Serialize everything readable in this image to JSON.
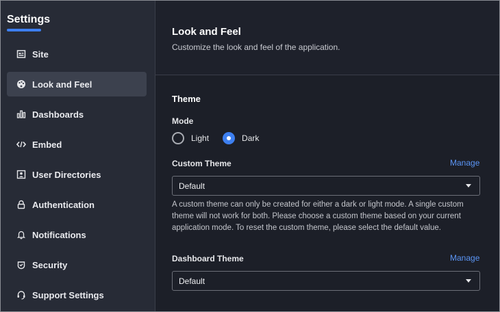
{
  "sidebar": {
    "title": "Settings",
    "items": [
      {
        "label": "Site",
        "icon": "site-icon",
        "active": false
      },
      {
        "label": "Look and Feel",
        "icon": "palette-icon",
        "active": true
      },
      {
        "label": "Dashboards",
        "icon": "bar-chart-icon",
        "active": false
      },
      {
        "label": "Embed",
        "icon": "code-icon",
        "active": false
      },
      {
        "label": "User Directories",
        "icon": "contact-card-icon",
        "active": false
      },
      {
        "label": "Authentication",
        "icon": "lock-icon",
        "active": false
      },
      {
        "label": "Notifications",
        "icon": "bell-icon",
        "active": false
      },
      {
        "label": "Security",
        "icon": "shield-icon",
        "active": false
      },
      {
        "label": "Support Settings",
        "icon": "headset-icon",
        "active": false
      }
    ]
  },
  "header": {
    "title": "Look and Feel",
    "subtitle": "Customize the look and feel of the application."
  },
  "theme": {
    "section_title": "Theme",
    "mode_label": "Mode",
    "modes": [
      {
        "label": "Light",
        "checked": false
      },
      {
        "label": "Dark",
        "checked": true
      }
    ],
    "custom_theme_label": "Custom Theme",
    "custom_theme_manage": "Manage",
    "custom_theme_value": "Default",
    "custom_theme_help": "A custom theme can only be created for either a dark or light mode. A single custom theme will not work for both. Please choose a custom theme based on your current application mode. To reset the custom theme, please select the default value.",
    "dashboard_theme_label": "Dashboard Theme",
    "dashboard_theme_manage": "Manage",
    "dashboard_theme_value": "Default"
  },
  "colors": {
    "accent": "#3d7ff0",
    "link": "#5b95f5",
    "sidebar_bg": "#272b36",
    "main_bg": "#1c1f28",
    "active_item_bg": "#3c414e"
  }
}
